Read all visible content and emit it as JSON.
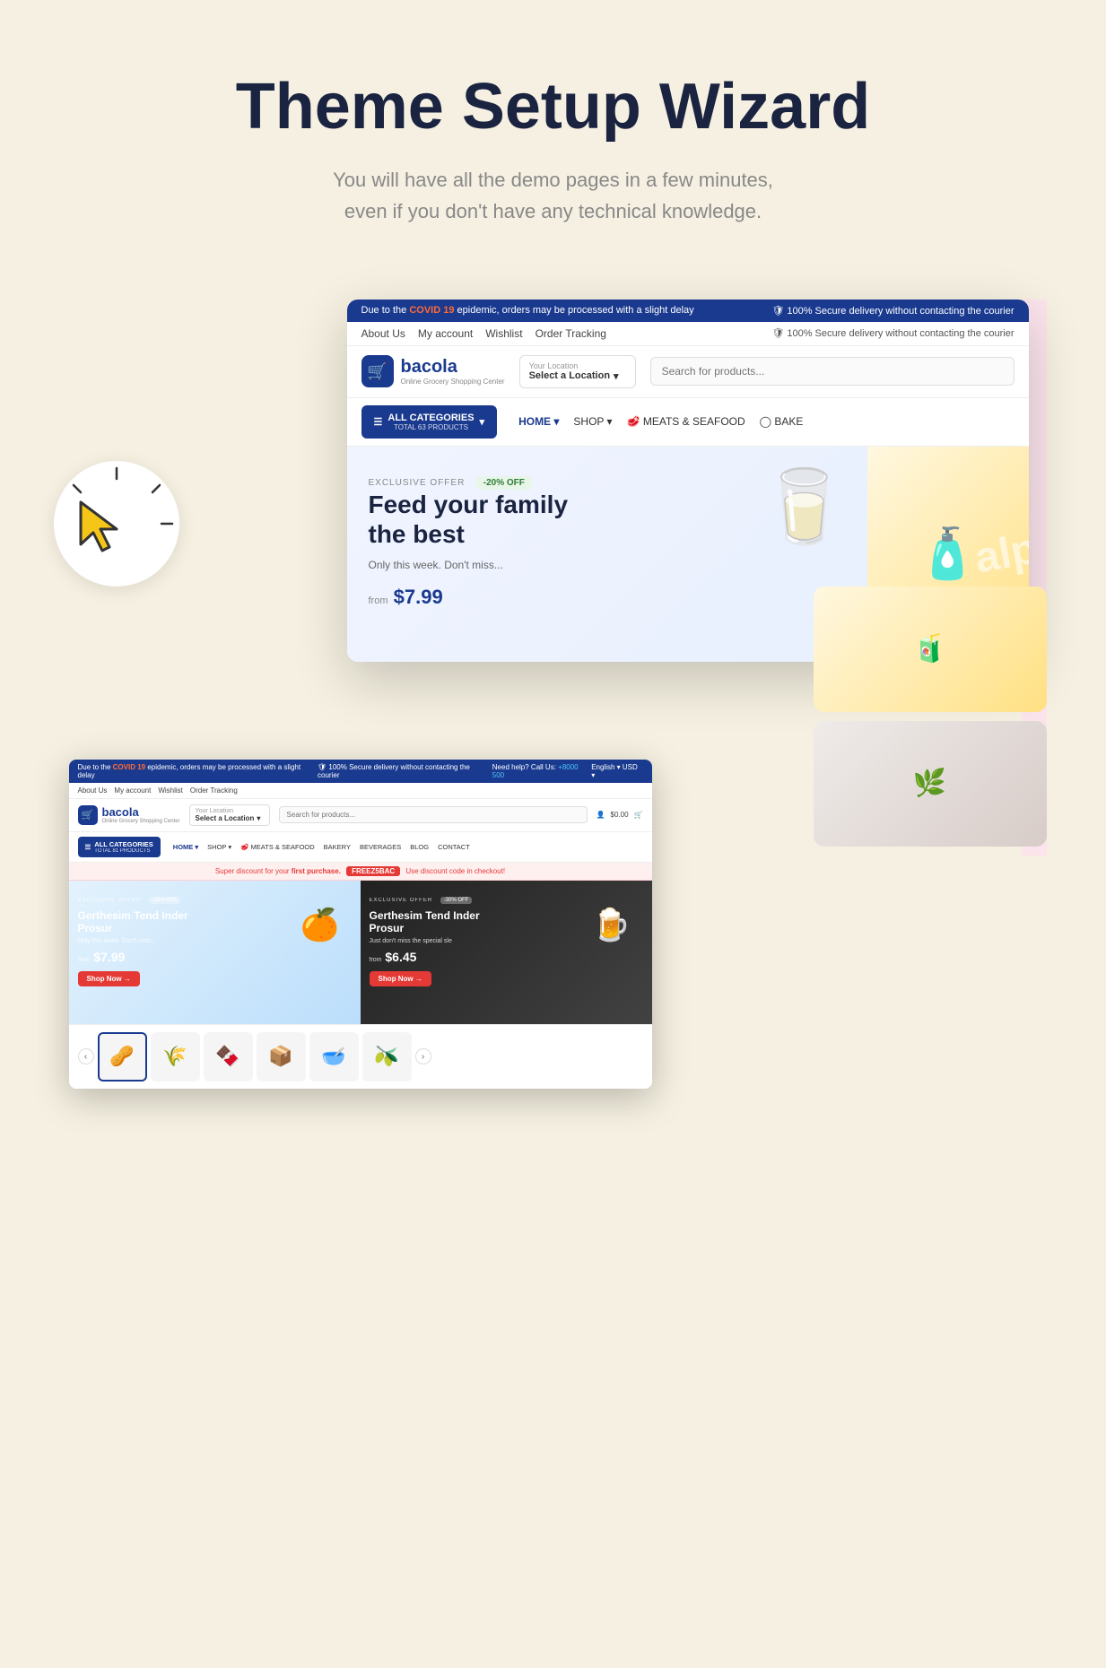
{
  "page": {
    "background_color": "#f5f0e1"
  },
  "hero": {
    "title": "Theme Setup Wizard",
    "subtitle_line1": "You will have all the demo pages in a few minutes,",
    "subtitle_line2": "even if you don't have any technical knowledge."
  },
  "large_browser": {
    "announce_bar": {
      "left": "Due to the COVID 19 epidemic, orders may be processed with a slight delay",
      "highlight": "COVID 19",
      "right": "100% Secure delivery without contacting the courier"
    },
    "nav": {
      "links": [
        "About Us",
        "My account",
        "Wishlist",
        "Order Tracking"
      ],
      "secure_text": "100% Secure delivery without contacting the courier"
    },
    "header": {
      "logo_name": "bacola",
      "logo_sub": "Online Grocery Shopping Center",
      "location_label": "Your Location",
      "location_value": "Select a Location",
      "search_placeholder": "Search for products..."
    },
    "categories_bar": {
      "all_cats_label": "ALL CATEGORIES",
      "total_label": "TOTAL 63 PRODUCTS",
      "nav_items": [
        "HOME",
        "SHOP",
        "MEATS & SEAFOOD",
        "BAKE"
      ]
    },
    "banner": {
      "exclusive_label": "EXCLUSIVE OFFER",
      "discount_badge": "-20% OFF",
      "title_line1": "Feed your family",
      "title_line2": "the best",
      "subtitle": "Only this week. Don't miss...",
      "price_from": "from",
      "price": "$7.99"
    }
  },
  "small_browser": {
    "announce_bar": {
      "left": "Due to the COVID 19 epidemic, orders may be processed with a slight delay",
      "highlight": "COVID 19",
      "right_need": "Need help? Call Us:",
      "right_phone": "+8000 500",
      "language": "English",
      "currency": "USD"
    },
    "nav": {
      "links": [
        "About Us",
        "My account",
        "Wishlist",
        "Order Tracking"
      ]
    },
    "header": {
      "logo_name": "bacola",
      "logo_sub": "Online Grocery Shopping Center",
      "location_value": "Select a Location",
      "search_placeholder": "Search for products...",
      "price": "$0.00"
    },
    "categories_bar": {
      "all_cats_label": "ALL CATEGORIES",
      "total_label": "TOTAL 81 PRODUCTS",
      "nav_items": [
        "HOME",
        "SHOP",
        "MEATS & SEAFOOD",
        "BAKERY",
        "BEVERAGES",
        "BLOG",
        "CONTACT"
      ]
    },
    "promo_bar": {
      "text": "Super discount for your first purchase.",
      "first_purchase": "first purchase.",
      "code": "FREEZ5BAC",
      "suffix": "Use discount code in checkout!"
    },
    "product_cards": [
      {
        "exclusive": "EXCLUSIVE OFFER",
        "badge": "-20% OFF",
        "title": "Gerthesim Tend Inder Prosur",
        "subtitle": "Only this week. Don't miss...",
        "price_from": "from",
        "price": "$7.99",
        "shop_label": "Shop Now →",
        "emoji": "🍊",
        "style": "light"
      },
      {
        "exclusive": "EXCLUSIVE OFFER",
        "badge": "-30% OFF",
        "title": "Gerthesim Tend Inder Prosur",
        "subtitle": "Just don't miss the special sle",
        "price_from": "from",
        "price": "$6.45",
        "shop_label": "Shop Now →",
        "emoji": "🍺",
        "style": "dark"
      }
    ],
    "thumbnails": [
      "🥜",
      "🌾",
      "🍫",
      "📦",
      "🥣",
      "🫒"
    ]
  }
}
